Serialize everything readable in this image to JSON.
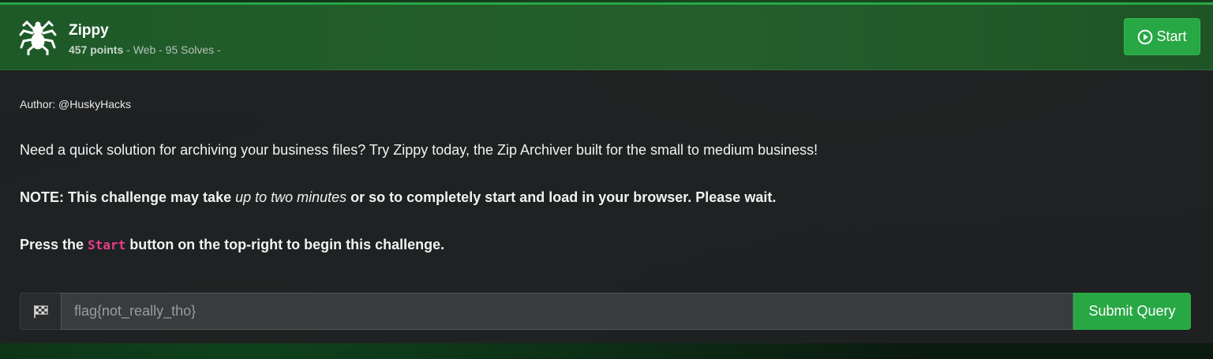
{
  "challenge": {
    "name": "Zippy",
    "points": "457 points",
    "meta_rest": " - Web - 95 Solves -",
    "start_label": "Start"
  },
  "body": {
    "author": "Author: @HuskyHacks",
    "description": "Need a quick solution for archiving your business files? Try Zippy today, the Zip Archiver built for the small to medium business!",
    "note_prefix": "NOTE: This challenge may take ",
    "note_emphasis": "up to two minutes",
    "note_suffix": " or so to completely start and load in your browser. Please wait.",
    "press_prefix": "Press the ",
    "press_code": "Start",
    "press_suffix": " button on the top-right to begin this challenge."
  },
  "flag_form": {
    "placeholder": "flag{not_really_tho}",
    "submit_label": "Submit Query"
  },
  "colors": {
    "accent": "#28a745",
    "code": "#e83e8c"
  },
  "icons": [
    "spider-icon",
    "play-circle-icon",
    "checkered-flag-icon"
  ]
}
